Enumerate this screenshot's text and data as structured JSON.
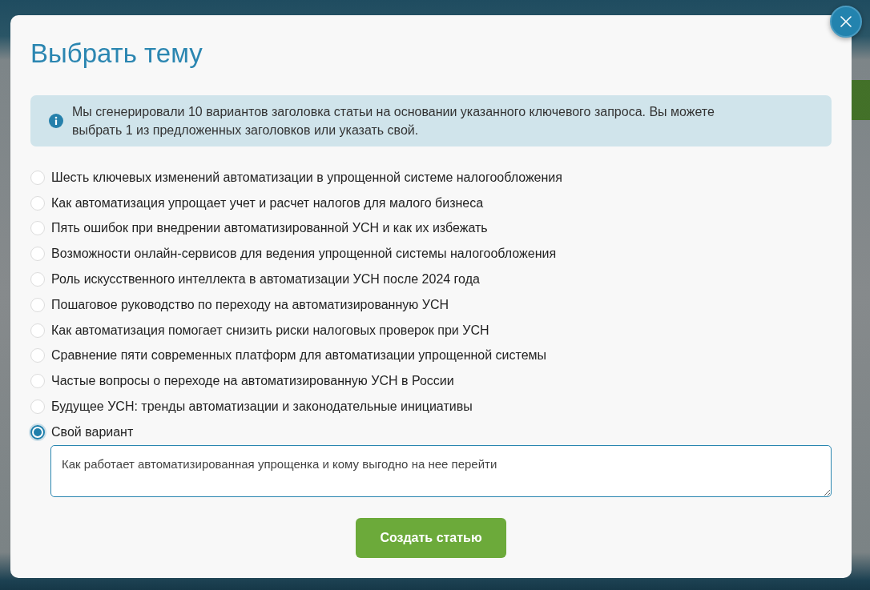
{
  "dialog": {
    "title": "Выбрать тему",
    "notice": {
      "text": "Мы сгенерировали 10 вариантов заголовка статьи на основании указанного ключевого запроса. Вы можете выбрать 1 из предложенных заголовков или указать свой."
    },
    "options": [
      {
        "label": "Шесть ключевых изменений автоматизации в упрощенной системе налогообложения",
        "selected": false
      },
      {
        "label": "Как автоматизация упрощает учет и расчет налогов для малого бизнеса",
        "selected": false
      },
      {
        "label": "Пять ошибок при внедрении автоматизированной УСН и как их избежать",
        "selected": false
      },
      {
        "label": "Возможности онлайн-сервисов для ведения упрощенной системы налогообложения",
        "selected": false
      },
      {
        "label": "Роль искусственного интеллекта в автоматизации УСН после 2024 года",
        "selected": false
      },
      {
        "label": "Пошаговое руководство по переходу на автоматизированную УСН",
        "selected": false
      },
      {
        "label": "Как автоматизация помогает снизить риски налоговых проверок при УСН",
        "selected": false
      },
      {
        "label": "Сравнение пяти современных платформ для автоматизации упрощенной системы",
        "selected": false
      },
      {
        "label": "Частые вопросы о переходе на автоматизированную УСН в России",
        "selected": false
      },
      {
        "label": "Будущее УСН: тренды автоматизации и законодательные инициативы",
        "selected": false
      },
      {
        "label": "Свой вариант",
        "selected": true
      }
    ],
    "custom_field": {
      "value": "Как работает автоматизированная упрощенка и кому выгодно на нее перейти"
    },
    "submit_button": {
      "label": "Создать статью"
    }
  }
}
